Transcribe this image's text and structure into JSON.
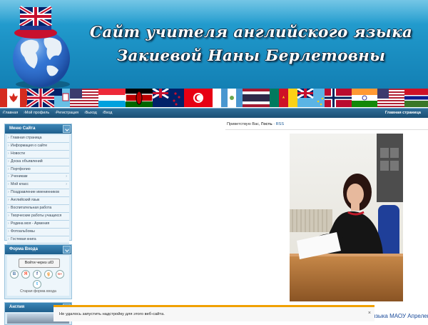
{
  "header": {
    "title_line1": "Сайт учителя английского языка",
    "title_line2": "Закиевой Наны Берлетовны"
  },
  "flags": [
    "canada",
    "uk",
    "fiji",
    "usa",
    "luxembourg",
    "kenya",
    "uk",
    "new-zealand",
    "tunisia",
    "guatemala",
    "usa",
    "thailand",
    "cameroon",
    "tuvalu",
    "norway",
    "india",
    "usa",
    "gambia"
  ],
  "nav": {
    "links": [
      "Главная",
      "Мой профиль",
      "Регистрация",
      "Выход",
      "Вход"
    ],
    "right_label": "Главная страница"
  },
  "menu": {
    "title": "Меню Сайта",
    "items": [
      {
        "label": "Главная страница",
        "arrow": ""
      },
      {
        "label": "Информация о сайте",
        "arrow": ""
      },
      {
        "label": "Новости",
        "arrow": ""
      },
      {
        "label": "Доска объявлений",
        "arrow": ""
      },
      {
        "label": "Портфолио",
        "arrow": ""
      },
      {
        "label": "Ученикам",
        "arrow": "›"
      },
      {
        "label": "Мой класс",
        "arrow": "›"
      },
      {
        "label": "Поздравление именинников",
        "arrow": ""
      },
      {
        "label": "Английский язык",
        "arrow": ""
      },
      {
        "label": "Воспитательная работа",
        "arrow": ""
      },
      {
        "label": "Творческие работы учащихся",
        "arrow": ""
      },
      {
        "label": "Родина моя - Армения",
        "arrow": ""
      },
      {
        "label": "Фотоальбомы",
        "arrow": ""
      },
      {
        "label": "Гостевая книга",
        "arrow": ""
      }
    ]
  },
  "login": {
    "title": "Форма Входа",
    "button": "Войти через uID",
    "social": [
      "В",
      "Я",
      "f",
      "g",
      "G+",
      "t"
    ],
    "old_form": "Старая форма входа"
  },
  "england": {
    "title": "Англия"
  },
  "content": {
    "greeting_prefix": "Приветствую Вас,",
    "greeting_user": "Гость",
    "greeting_sep": "·",
    "rss": "RSS",
    "caption": "языка МАОУ Апрелевс"
  },
  "notification": {
    "message": "Не удалось запустить надстройку для этого веб-сайта.",
    "close": "×"
  },
  "colors": {
    "header_blue": "#1d93c6",
    "nav_blue": "#1b4f74",
    "block_head": "#2b6f9e",
    "notif_accent": "#f0a000",
    "caption_link": "#1a4b9a"
  }
}
